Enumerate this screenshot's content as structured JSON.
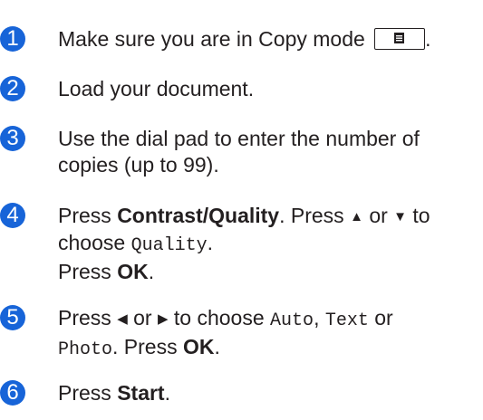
{
  "steps": [
    {
      "number": "1",
      "parts": {
        "text": "Make sure you are in Copy mode",
        "end": "."
      },
      "icon": "copy-mode-key-icon"
    },
    {
      "number": "2",
      "parts": {
        "text": "Load your document."
      }
    },
    {
      "number": "3",
      "parts": {
        "line1": "Use the dial pad to enter the number of",
        "line2": "copies (up to 99)."
      }
    },
    {
      "number": "4",
      "parts": {
        "press": "Press",
        "key": "Contrast/Quality",
        "dot": ".",
        "press2": "Press",
        "up": "▲",
        "or": "or",
        "down": "▼",
        "to": "to",
        "choose": "choose",
        "option": "Quality",
        "end": ".",
        "press3": "Press",
        "ok": "OK",
        "end2": "."
      }
    },
    {
      "number": "5",
      "parts": {
        "press": "Press",
        "left": "◀",
        "or": "or",
        "right": "▶",
        "to_choose": "to choose",
        "opt1": "Auto",
        "comma": ",",
        "opt2": "Text",
        "or2": "or",
        "opt3": "Photo",
        "dot": ".",
        "press2": "Press",
        "ok": "OK",
        "end": "."
      }
    },
    {
      "number": "6",
      "parts": {
        "press": "Press",
        "key": "Start",
        "end": "."
      }
    }
  ],
  "colors": {
    "badge": "#1764d8",
    "text": "#231f20"
  }
}
